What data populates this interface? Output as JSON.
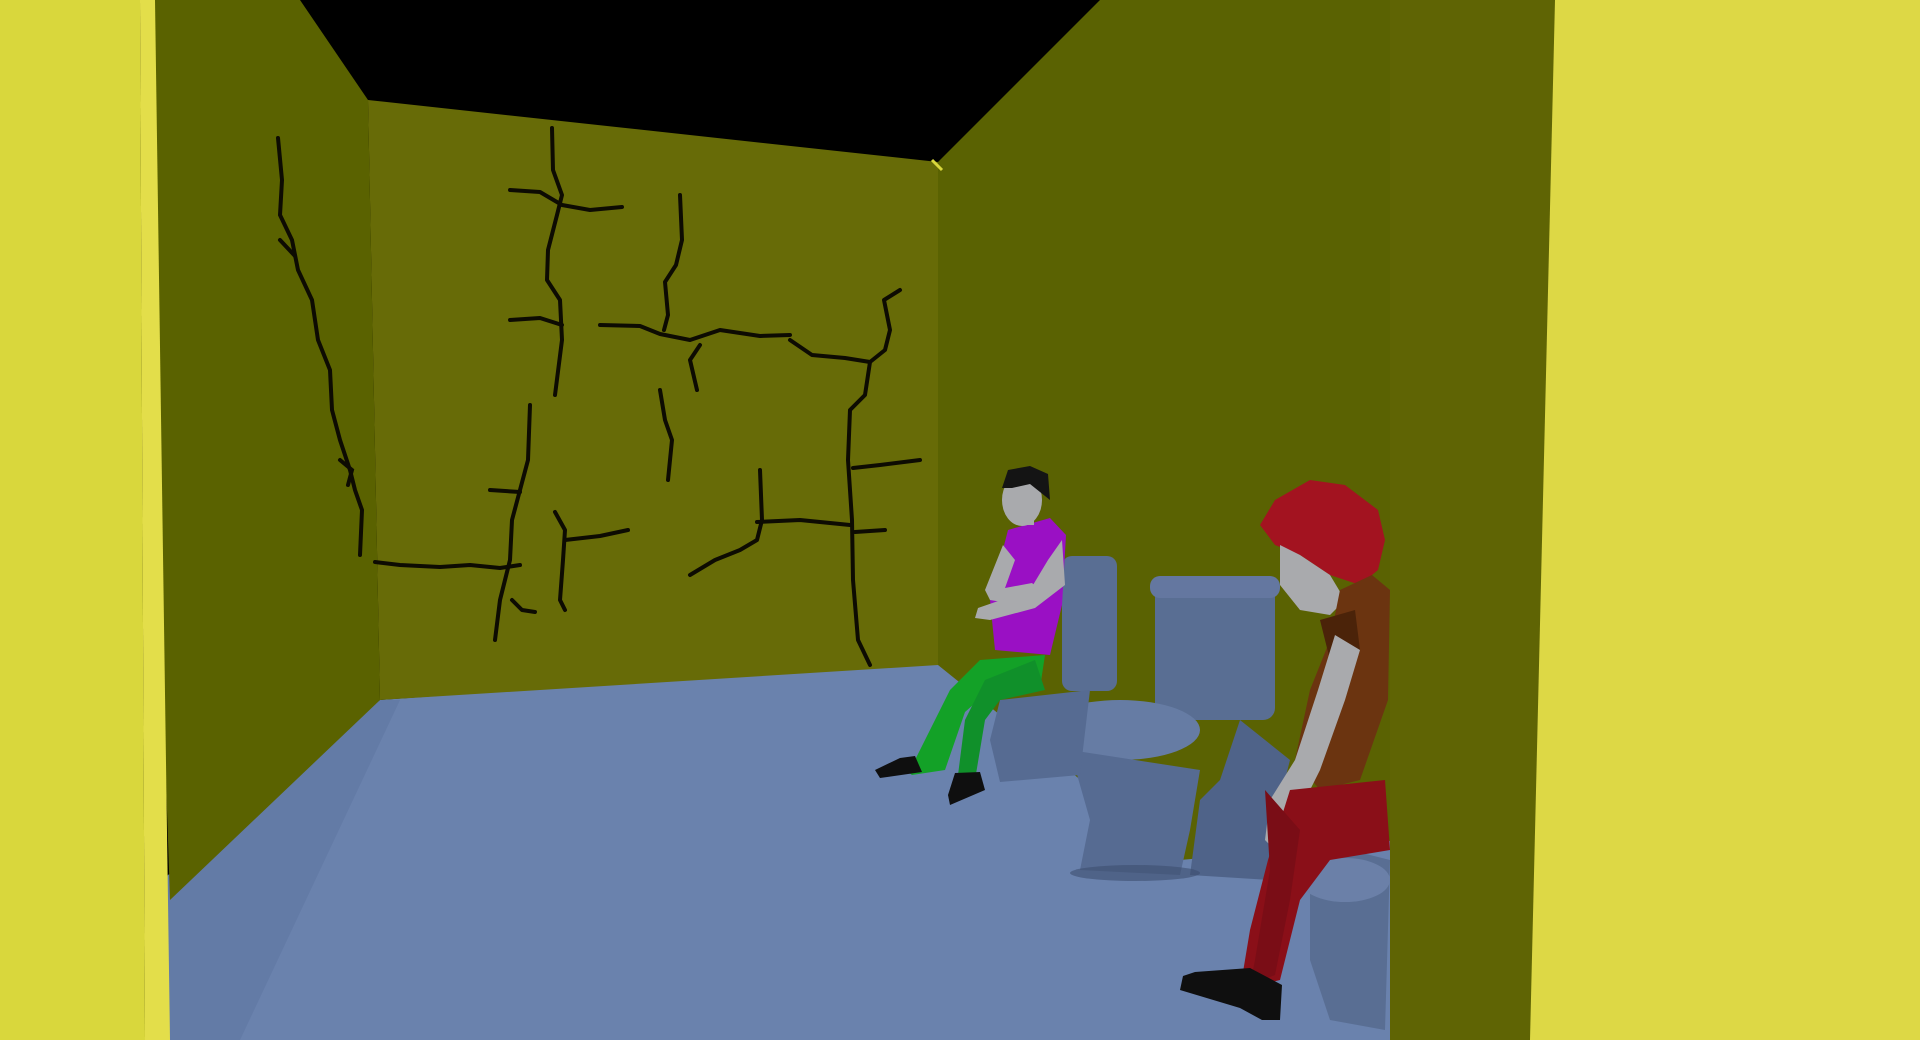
{
  "scene": {
    "colors": {
      "ceiling": "#000000",
      "left_wall": "#5a6200",
      "back_wall": "#676b07",
      "right_wall": "#5a6202",
      "near_pillar_left": "#d9d73c",
      "near_pillar_right": "#ddd845",
      "near_wall_right": "#5f6404",
      "floor": "#6a82ad",
      "toilet": "#596e93",
      "toilet_shadow": "#4a5d80",
      "crack": "#0d0b02",
      "skin": "#a9aaad",
      "hair_dark": "#141414",
      "shirt_purple": "#9a10c4",
      "pants_green": "#13a127",
      "shoe_black": "#0f0f0f",
      "hair_red": "#a31320",
      "shirt_brown": "#6b3410",
      "pants_red": "#8a0f18"
    },
    "icons": {
      "npc_seated": "person-seated",
      "npc_red": "person-leaning",
      "toilet": "toilet",
      "wall_crack": "crack-lines"
    }
  }
}
